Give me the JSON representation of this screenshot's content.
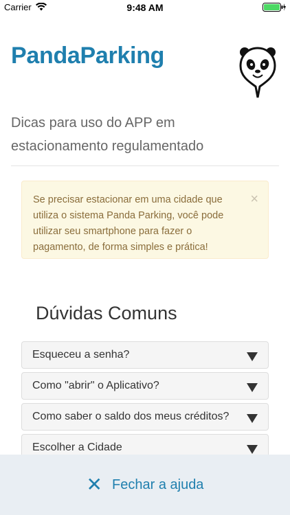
{
  "status_bar": {
    "carrier": "Carrier",
    "time": "9:48 AM"
  },
  "header": {
    "title": "PandaParking",
    "subtitle": "Dicas para uso do APP em estacionamento regulamentado"
  },
  "alert": {
    "text": "Se precisar estacionar em uma cidade que utiliza o sistema Panda Parking, você pode utilizar seu smartphone para fazer o pagamento, de forma simples e prática!",
    "close_symbol": "×"
  },
  "faq": {
    "heading": "Dúvidas Comuns",
    "items": [
      {
        "label": "Esqueceu a senha?"
      },
      {
        "label": "Como \"abrir\" o Aplicativo?"
      },
      {
        "label": "Como saber o saldo dos meus créditos?"
      },
      {
        "label": "Escolher a Cidade"
      }
    ]
  },
  "footer": {
    "close_symbol": "✕",
    "close_label": "Fechar a ajuda"
  },
  "colors": {
    "brand": "#1f7fae",
    "alert_bg": "#fcf8e3",
    "alert_text": "#8a6d3b",
    "bottom_bar_bg": "#e9eef3"
  }
}
